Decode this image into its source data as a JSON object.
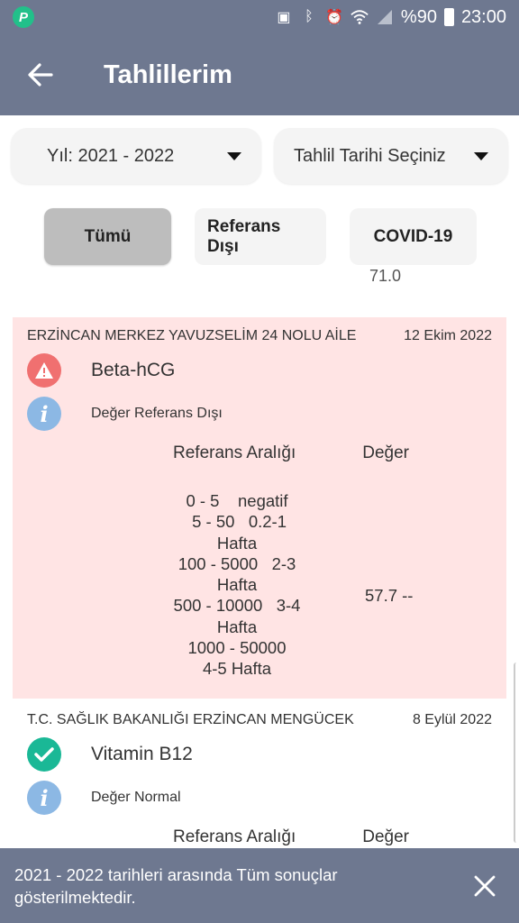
{
  "status_bar": {
    "app_badge": "P",
    "battery": "%90",
    "time": "23:00",
    "icons": [
      "sim-icon",
      "bluetooth-icon",
      "alarm-icon",
      "wifi-icon",
      "signal-icon",
      "battery-icon"
    ]
  },
  "header": {
    "title": "Tahlillerim",
    "back_icon": "arrow-left-icon"
  },
  "filters": {
    "year": "Yıl: 2021 - 2022",
    "date": "Tahlil Tarihi Seçiniz"
  },
  "chips": [
    {
      "label": "Tümü",
      "active": true
    },
    {
      "label": "Referans Dışı",
      "active": false
    },
    {
      "label": "COVID-19",
      "active": false
    }
  ],
  "peek_text": "71.0",
  "results": [
    {
      "institution": "ERZİNCAN MERKEZ YAVUZSELİM 24 NOLU AİLE",
      "date": "12 Ekim 2022",
      "test": "Beta-hCG",
      "status": "Değer Referans Dışı",
      "ref_header": "Referans Aralığı",
      "value_header": "Değer",
      "reference_lines": [
        "0 - 5    negatif",
        " 5 - 50   0.2-1",
        "Hafta",
        "100 - 5000   2-3",
        "Hafta",
        "500 - 10000   3-4",
        "Hafta",
        "1000 - 50000",
        "4-5 Hafta"
      ],
      "value": "57.7 --",
      "background": "#ffe4e4"
    },
    {
      "institution": "T.C. SAĞLIK BAKANLIĞI ERZİNCAN MENGÜCEK",
      "date": "8 Eylül 2022",
      "test": "Vitamin B12",
      "status": "Değer Normal",
      "ref_header": "Referans Aralığı",
      "value_header": "Değer"
    }
  ],
  "snackbar": {
    "message": "2021 - 2022 tarihleri arasında Tüm sonuçlar gösterilmektedir.",
    "close_icon": "close-icon"
  },
  "colors": {
    "primary": "#6e7890",
    "warning": "#f07070",
    "info": "#8cb8e4",
    "success": "#1ab896",
    "out_of_range_bg": "#ffe4e4"
  }
}
